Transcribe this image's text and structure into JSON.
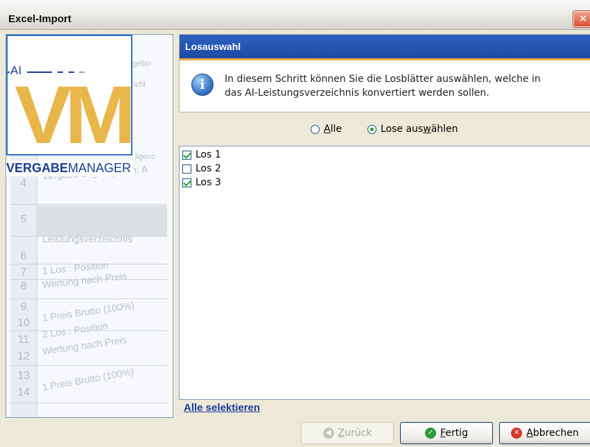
{
  "window": {
    "title": "Excel-Import",
    "close_symbol": "✕"
  },
  "logo": {
    "ai": "AI",
    "brand_bold": "VERGABE",
    "brand_regular": "MANAGER",
    "monogram": "VM"
  },
  "background_sheet": {
    "row_numbers": [
      "4",
      "5",
      "6",
      "7",
      "8",
      "9",
      "10",
      "11",
      "12",
      "13",
      "14"
    ],
    "cells": [
      "gebo",
      "icht",
      "ligenc",
      "Vergabe angelegt von: A",
      "Leistungsverzeichnis",
      "1 Los : Position",
      "Wertung nach Preis",
      "1 Preis Brutto (100%)",
      "2 Los : Position",
      "Wertung nach Preis",
      "1 Preis Brutto (100%)"
    ]
  },
  "header": {
    "title": "Losauswahl",
    "info_line1": "In diesem Schritt können Sie die Losblätter auswählen, welche in",
    "info_line2": "das AI-Leistungsverzeichnis konvertiert werden sollen."
  },
  "radios": {
    "all": {
      "mnemonic": "A",
      "rest": "lle",
      "selected": false
    },
    "select": {
      "before": "Lose aus",
      "mnemonic": "w",
      "after": "ählen",
      "selected": true
    }
  },
  "list": {
    "items": [
      {
        "label": "Los 1",
        "checked": true
      },
      {
        "label": "Los 2",
        "checked": false
      },
      {
        "label": "Los 3",
        "checked": true
      }
    ]
  },
  "select_all_label": "Alle selektieren",
  "buttons": {
    "back": {
      "mnemonic": "Z",
      "rest": "urück",
      "enabled": false
    },
    "finish": {
      "mnemonic": "F",
      "rest": "ertig",
      "enabled": true
    },
    "cancel": {
      "mnemonic": "A",
      "rest": "bbrechen",
      "enabled": true
    }
  },
  "colors": {
    "header_blue": "#2455b5",
    "accent_orange": "#f2a640",
    "logo_gold": "#e8b64b",
    "logo_navy": "#1a3d8f",
    "check_green": "#21a121"
  },
  "icons": {
    "info": "info-icon",
    "back": "back-arrow-icon",
    "finish": "checkmark-icon",
    "cancel": "cancel-x-icon"
  }
}
